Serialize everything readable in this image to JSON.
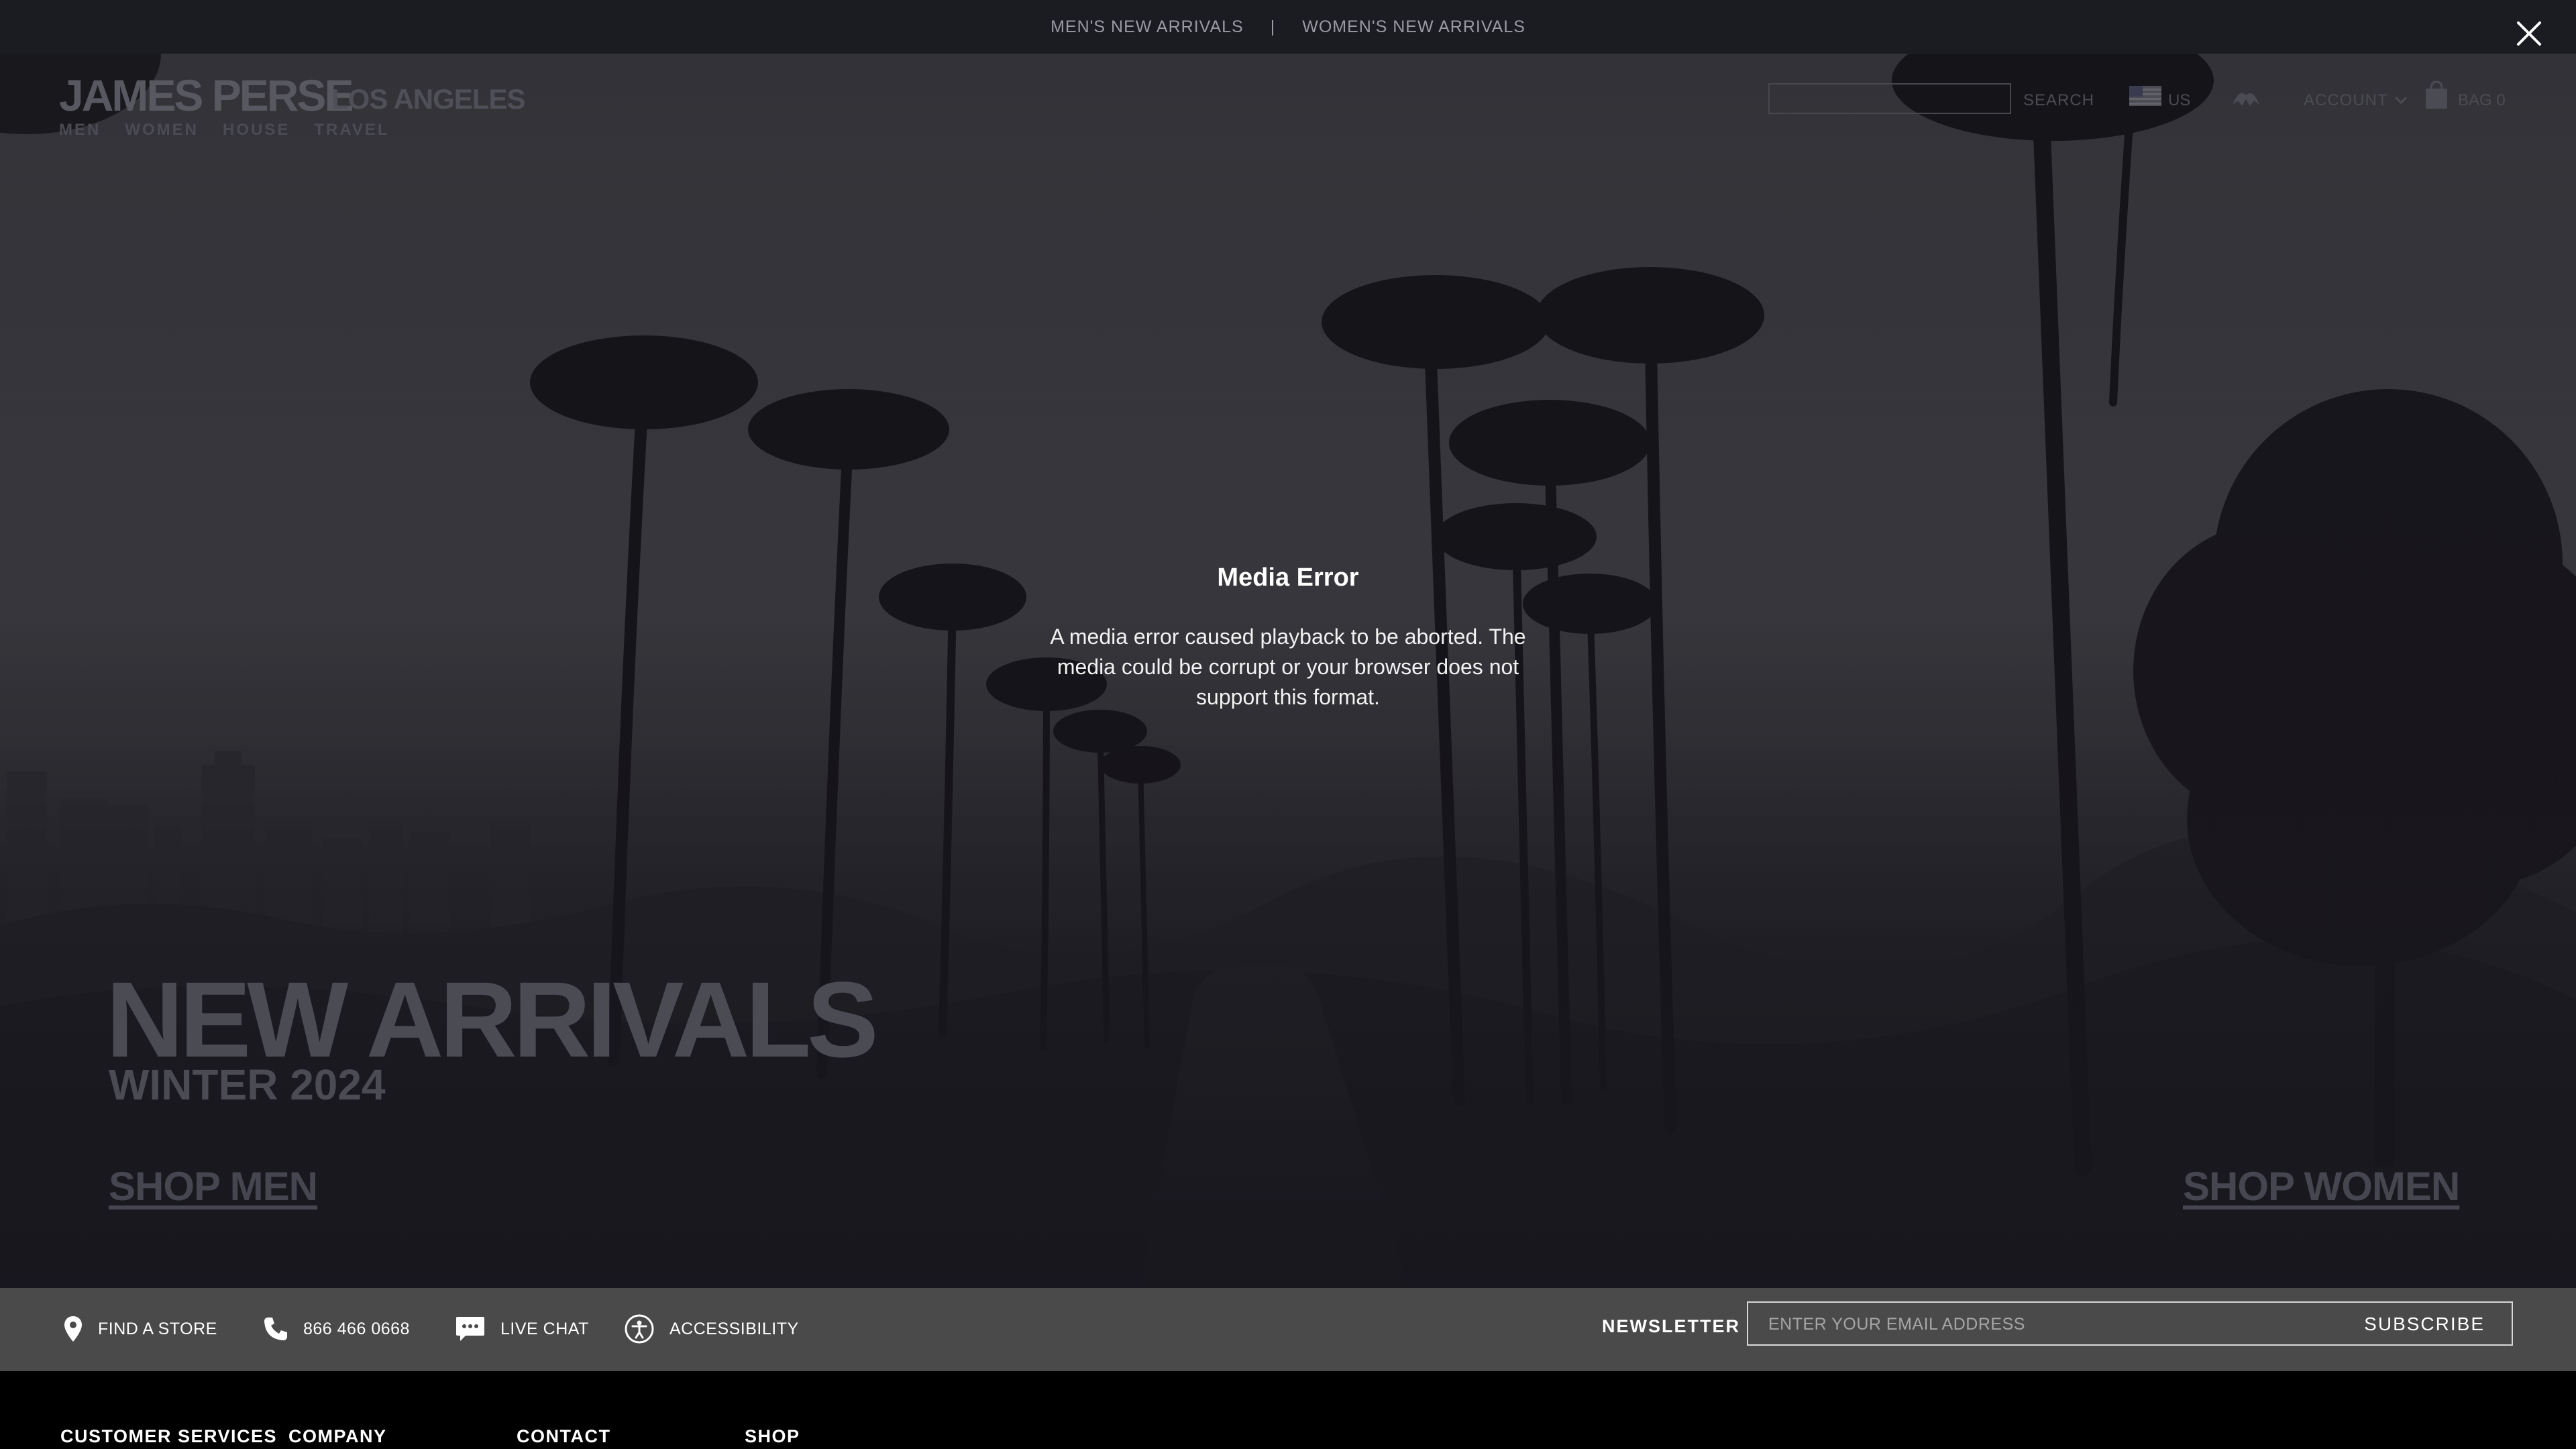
{
  "promo": {
    "mens_link": "MEN'S NEW ARRIVALS",
    "separator": "|",
    "womens_link": "WOMEN'S NEW ARRIVALS"
  },
  "header": {
    "logo": "JAMES PERSE",
    "logo_sub": "LOS ANGELES",
    "nav": [
      "MEN",
      "WOMEN",
      "HOUSE",
      "TRAVEL"
    ],
    "search_label": "SEARCH",
    "country": "US",
    "account_label": "ACCOUNT",
    "bag_label": "BAG 0"
  },
  "error": {
    "title": "Media Error",
    "message": "A media error caused playback to be aborted. The media could be corrupt or your browser does not support this format."
  },
  "hero": {
    "title": "NEW ARRIVALS",
    "season": "WINTER 2024",
    "shop_men": "SHOP MEN",
    "shop_women": "SHOP WOMEN"
  },
  "service_bar": {
    "find_store": "FIND A STORE",
    "phone": "866 466 0668",
    "live_chat": "LIVE CHAT",
    "accessibility": "ACCESSIBILITY",
    "newsletter_label": "NEWSLETTER",
    "email_placeholder": "ENTER YOUR EMAIL ADDRESS",
    "subscribe_label": "SUBSCRIBE"
  },
  "footer": {
    "col1": "CUSTOMER SERVICES",
    "col2": "COMPANY",
    "col3": "CONTACT",
    "col4": "SHOP"
  },
  "icons": {
    "close": "close-icon",
    "location": "location-pin-icon",
    "phone": "phone-icon",
    "chat": "chat-bubble-icon",
    "accessibility": "accessibility-icon",
    "flag": "us-flag-icon",
    "bag": "shopping-bag-icon"
  }
}
